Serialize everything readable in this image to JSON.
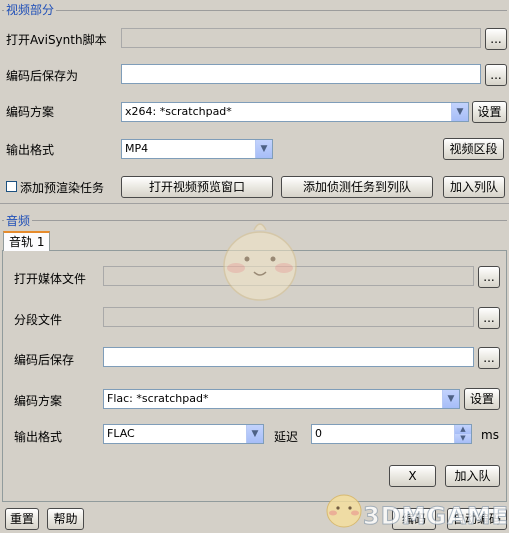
{
  "video": {
    "group_title": "视频部分",
    "open_avisynth_label": "打开AviSynth脚本",
    "save_after_encode_label": "编码后保存为",
    "encode_scheme_label": "编码方案",
    "encode_scheme_value": "x264: *scratchpad*",
    "settings_button": "设置",
    "output_format_label": "输出格式",
    "output_format_value": "MP4",
    "video_segment_button": "视频区段",
    "add_prerender_label": "添加预渲染任务",
    "preview_window_button": "打开视频预览窗口",
    "add_detect_task_button": "添加侦测任务到列队",
    "add_queue_button": "加入列队",
    "browse_label": "..."
  },
  "audio": {
    "group_title": "音频",
    "tab_label": "音轨 1",
    "open_media_label": "打开媒体文件",
    "segment_file_label": "分段文件",
    "save_after_encode_label": "编码后保存",
    "encode_scheme_label": "编码方案",
    "encode_scheme_value": "Flac: *scratchpad*",
    "settings_button": "设置",
    "output_format_label": "输出格式",
    "output_format_value": "FLAC",
    "delay_label": "延迟",
    "delay_value": "0",
    "delay_unit": "ms",
    "remove_button": "X",
    "add_queue_button": "加入队",
    "browse_label": "..."
  },
  "footer": {
    "reset_button": "重置",
    "help_button": "帮助",
    "encode_button": "编码",
    "auto_encode_button": "自动编码"
  },
  "watermark": {
    "text": "3DMGAME"
  }
}
